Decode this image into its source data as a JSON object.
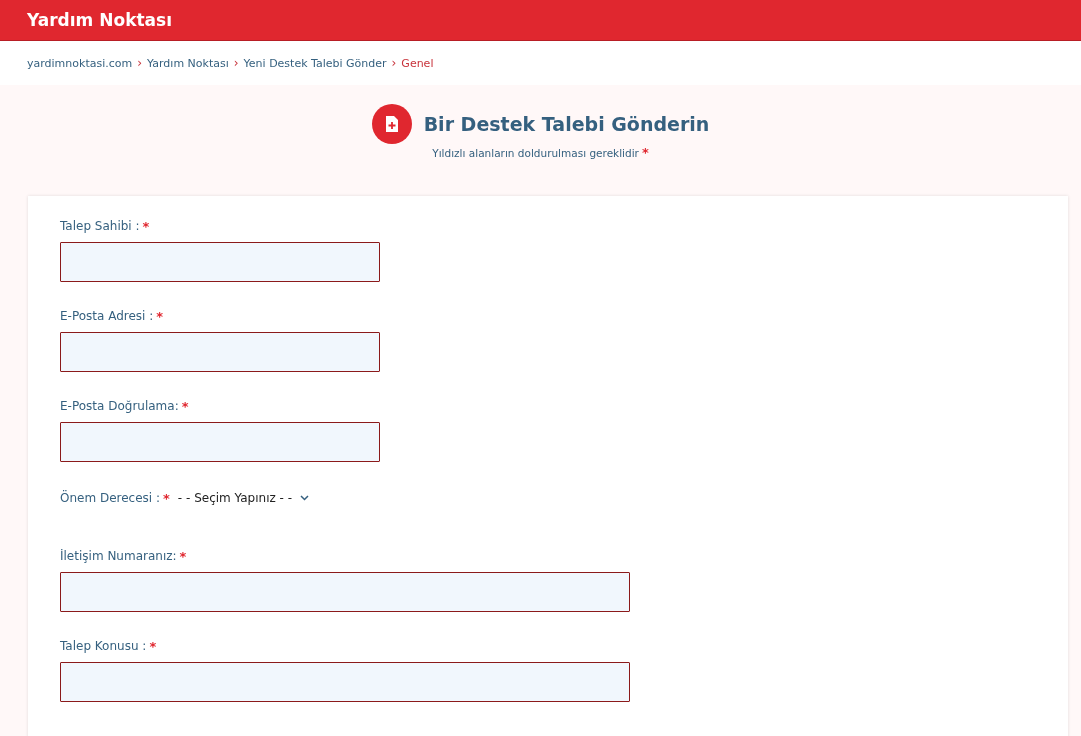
{
  "header": {
    "title": "Yardım Noktası"
  },
  "breadcrumb": [
    {
      "label": "yardimnoktasi.com",
      "current": false
    },
    {
      "label": "Yardım Noktası",
      "current": false
    },
    {
      "label": "Yeni Destek Talebi Gönder",
      "current": false
    },
    {
      "label": "Genel",
      "current": true
    }
  ],
  "breadcrumb_separator": "›",
  "heading": {
    "title": "Bir Destek Talebi Gönderin",
    "subtitle": "Yıldızlı alanların doldurulması gereklidir",
    "mark": "*"
  },
  "fields": [
    {
      "kind": "short",
      "label": "Talep Sahibi :",
      "mark": "*"
    },
    {
      "kind": "short",
      "label": "E-Posta Adresi :",
      "mark": "*"
    },
    {
      "kind": "short",
      "label": "E-Posta Doğrulama:",
      "mark": "*"
    },
    {
      "kind": "select",
      "label": "Önem Derecesi :",
      "mark": "*",
      "value": "- - Seçim Yapınız - -"
    },
    {
      "kind": "wide",
      "label": "İletişim Numaranız:",
      "mark": "*"
    },
    {
      "kind": "wide",
      "label": "Talep Konusu :",
      "mark": "*"
    }
  ]
}
